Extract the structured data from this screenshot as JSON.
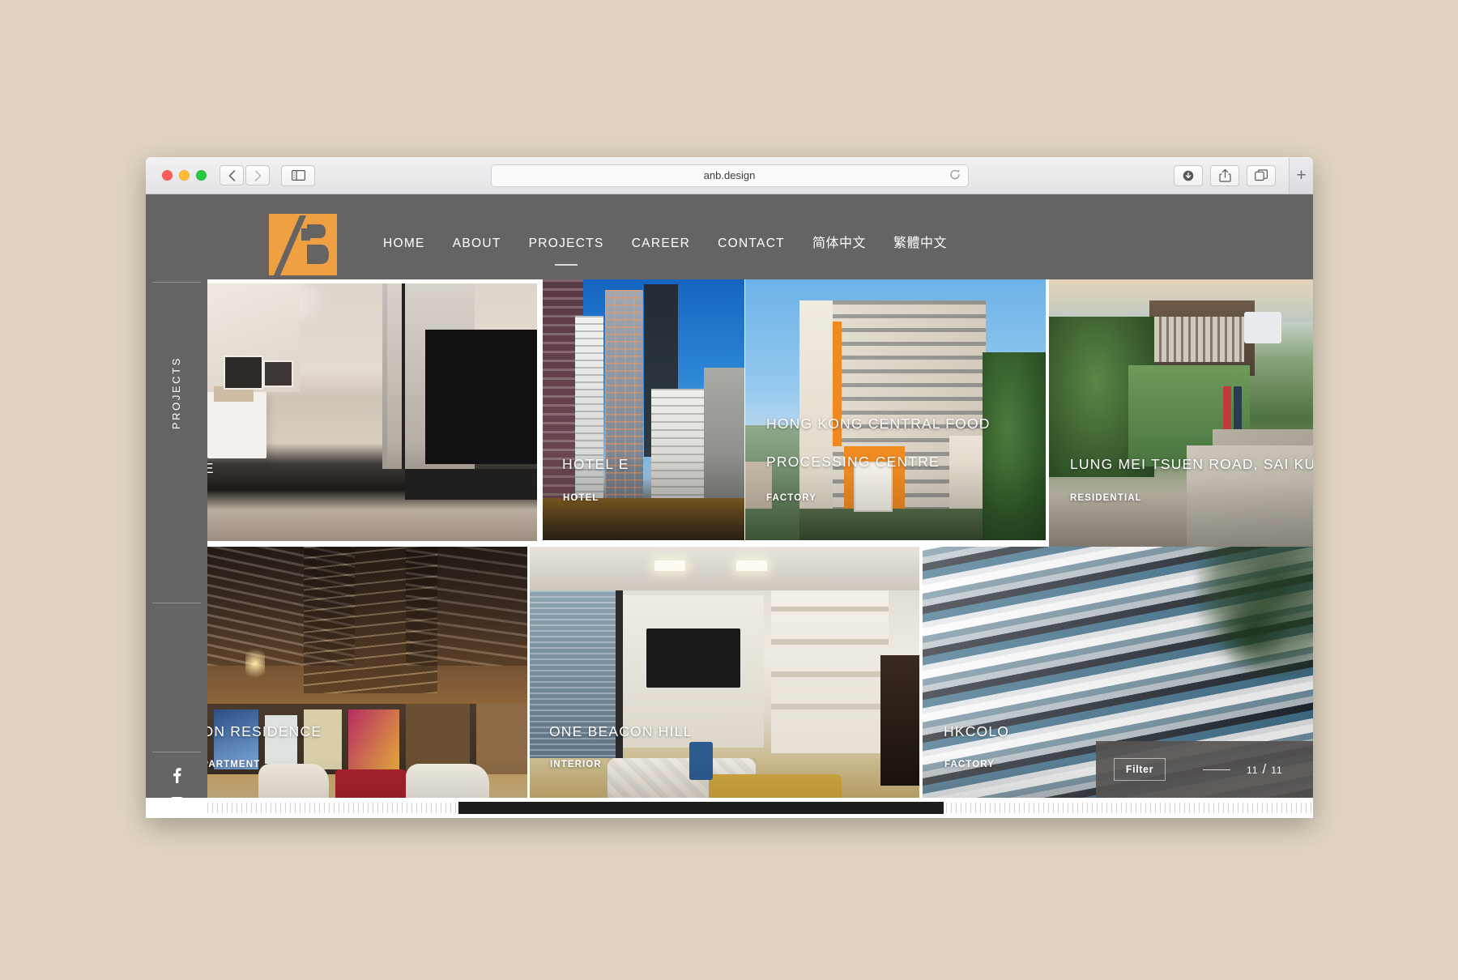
{
  "browser": {
    "url": "anb.design",
    "traffic_lights": [
      "close",
      "minimize",
      "zoom"
    ],
    "back_label": "Back",
    "forward_label": "Forward",
    "sidebar_toggle_label": "Show Sidebar",
    "reload_label": "Reload",
    "downloads_label": "Downloads",
    "share_label": "Share",
    "tab_overview_label": "Tab Overview",
    "new_tab_label": "+"
  },
  "site": {
    "logo_alt": "AB",
    "brand_color": "#efa043",
    "header_bg": "#666463",
    "nav": [
      {
        "label": "HOME",
        "active": false,
        "cjk": false
      },
      {
        "label": "ABOUT",
        "active": false,
        "cjk": false
      },
      {
        "label": "PROJECTS",
        "active": true,
        "cjk": false
      },
      {
        "label": "CAREER",
        "active": false,
        "cjk": false
      },
      {
        "label": "CONTACT",
        "active": false,
        "cjk": false
      },
      {
        "label": "简体中文",
        "active": false,
        "cjk": true
      },
      {
        "label": "繁體中文",
        "active": false,
        "cjk": true
      }
    ]
  },
  "rail": {
    "section_label": "PROJECTS",
    "social": [
      {
        "name": "facebook"
      },
      {
        "name": "instagram"
      }
    ]
  },
  "gallery": {
    "tiles": [
      {
        "title": "DE",
        "category": "",
        "partial": true
      },
      {
        "title": "HOTEL E",
        "category": "HOTEL",
        "partial": false
      },
      {
        "title": "HONG KONG CENTRAL FOOD",
        "title2": "PROCESSING CENTRE",
        "category": "FACTORY",
        "partial": false
      },
      {
        "title": "LUNG MEI TSUEN ROAD, SAI KUN",
        "category": "RESIDENTIAL",
        "partial": true
      },
      {
        "title": "TON RESIDENCE",
        "category": "APARTMENT",
        "partial": true
      },
      {
        "title": "ONE BEACON HILL",
        "category": "INTERIOR",
        "partial": false
      },
      {
        "title": "HKCOLO",
        "category": "FACTORY",
        "partial": false
      }
    ]
  },
  "filter": {
    "button_label": "Filter",
    "current": "11",
    "separator": "/",
    "total": "11"
  }
}
